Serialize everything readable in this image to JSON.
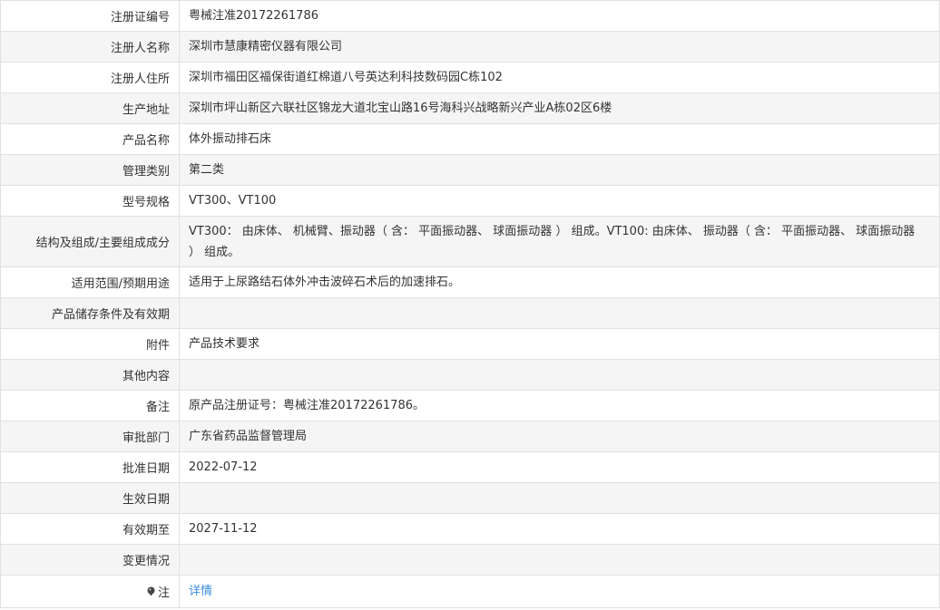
{
  "rows": [
    {
      "label": "注册证编号",
      "value": "粤械注准20172261786"
    },
    {
      "label": "注册人名称",
      "value": "深圳市慧康精密仪器有限公司"
    },
    {
      "label": "注册人住所",
      "value": "深圳市福田区福保街道红棉道八号英达利科技数码园C栋102"
    },
    {
      "label": "生产地址",
      "value": "深圳市坪山新区六联社区锦龙大道北宝山路16号海科兴战略新兴产业A栋02区6楼"
    },
    {
      "label": "产品名称",
      "value": "体外振动排石床"
    },
    {
      "label": "管理类别",
      "value": "第二类"
    },
    {
      "label": "型号规格",
      "value": "VT300、VT100"
    },
    {
      "label": "结构及组成/主要组成成分",
      "value": "VT300： 由床体、 机械臂、振动器（ 含： 平面振动器、 球面振动器 ） 组成。VT100: 由床体、 振动器（ 含： 平面振动器、 球面振动器 ） 组成。"
    },
    {
      "label": "适用范围/预期用途",
      "value": "适用于上尿路结石体外冲击波碎石术后的加速排石。"
    },
    {
      "label": "产品储存条件及有效期",
      "value": ""
    },
    {
      "label": "附件",
      "value": "产品技术要求"
    },
    {
      "label": "其他内容",
      "value": ""
    },
    {
      "label": "备注",
      "value": "原产品注册证号：粤械注准20172261786。"
    },
    {
      "label": "审批部门",
      "value": "广东省药品监督管理局"
    },
    {
      "label": "批准日期",
      "value": "2022-07-12"
    },
    {
      "label": "生效日期",
      "value": ""
    },
    {
      "label": "有效期至",
      "value": "2027-11-12"
    },
    {
      "label": "变更情况",
      "value": ""
    },
    {
      "label": "注",
      "value": "详情"
    }
  ],
  "icons": {
    "note_icon": "pin-icon"
  },
  "colors": {
    "link": "#3a8ee6",
    "stripe": "#f5f5f5",
    "border": "#e1e1e1"
  }
}
